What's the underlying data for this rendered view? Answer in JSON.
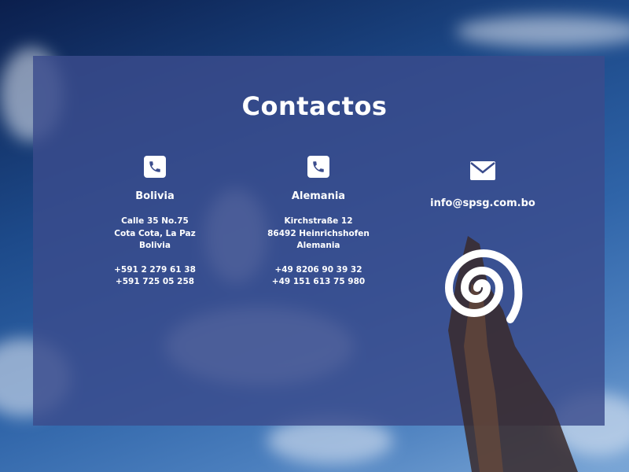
{
  "section": {
    "title": "Contactos"
  },
  "contacts": [
    {
      "icon": "phone-icon",
      "country": "Bolivia",
      "address": [
        "Calle 35 No.75",
        "Cota Cota, La Paz",
        "Bolivia"
      ],
      "phones": [
        "+591 2 279 61 38",
        "+591 725 05 258"
      ]
    },
    {
      "icon": "phone-icon",
      "country": "Alemania",
      "address": [
        "Kirchstraße 12",
        "86492 Heinrichshofen",
        "Alemania"
      ],
      "phones": [
        "+49 8206 90 39 32",
        "+49 151 613 75 980"
      ]
    },
    {
      "icon": "mail-icon",
      "email": "info@spsg.com.bo"
    }
  ],
  "colors": {
    "panel": "#3a4c8c",
    "text": "#ffffff",
    "sky": "#1d4a8a"
  }
}
